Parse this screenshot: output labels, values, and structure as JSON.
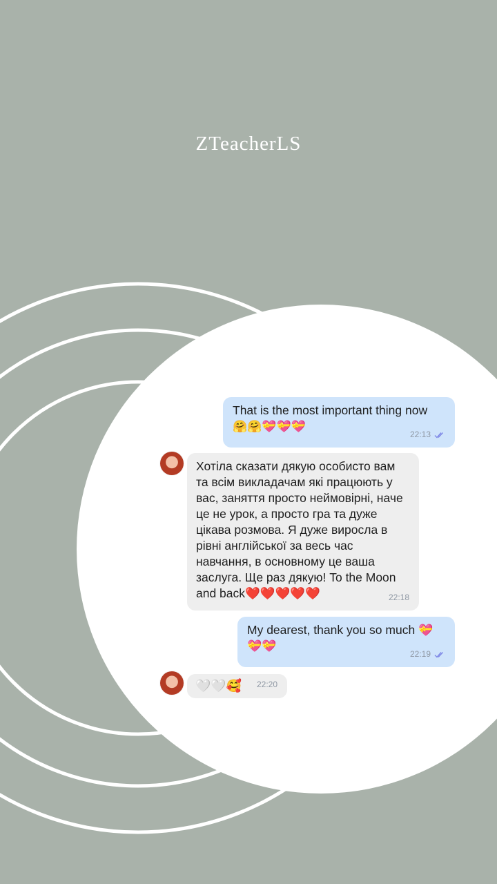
{
  "brand": {
    "title": "ZTeacherLS"
  },
  "chat": {
    "messages": [
      {
        "direction": "outgoing",
        "text": "That is the most important thing now",
        "emojis": "🤗🤗💝💝💝",
        "time": "22:13"
      },
      {
        "direction": "incoming",
        "text": "Хотіла сказати дякую особисто вам та всім викладачам які працюють у вас, заняття просто неймовірні, наче це не урок, а просто гра та дуже цікава розмова. Я дуже виросла в рівні англійської за весь час навчання, в основному це ваша заслуга. Ще раз дякую! To the Moon and back",
        "emojis": "❤️❤️❤️❤️❤️",
        "time": "22:18"
      },
      {
        "direction": "outgoing",
        "text": "My dearest, thank you so much",
        "emojis": "💝💝💝",
        "time": "22:19"
      },
      {
        "direction": "incoming",
        "text": "",
        "emojis": "🤍🤍🥰",
        "time": "22:20"
      }
    ]
  },
  "colors": {
    "background": "#a9b2aa",
    "outgoing_bubble": "#cfe4fb",
    "incoming_bubble": "#eeeeee",
    "read_ticks": "#7d86e6"
  }
}
